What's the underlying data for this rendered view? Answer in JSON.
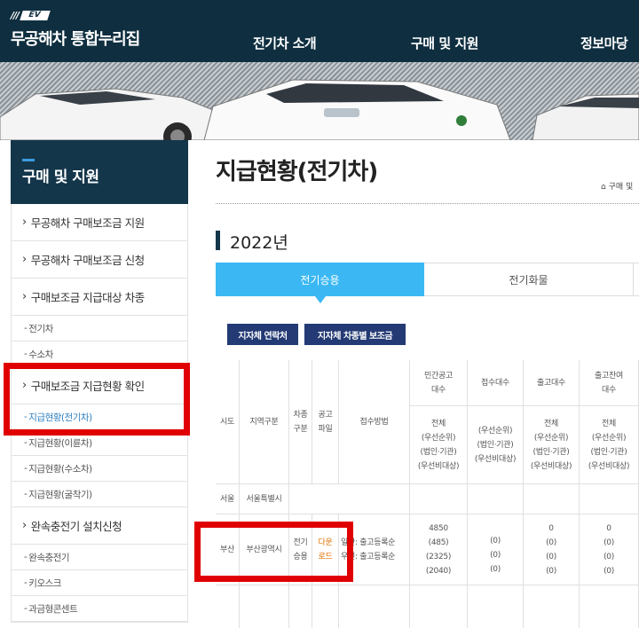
{
  "header": {
    "logo_slashes": "///",
    "logo_badge": "EV",
    "logo_title": "무공해차 통합누리집",
    "nav": [
      "전기차 소개",
      "구매 및 지원",
      "정보마당"
    ]
  },
  "sidebar": {
    "title": "구매 및 지원",
    "items": [
      {
        "label": "무공해차 구매보조금 지원",
        "type": "main"
      },
      {
        "label": "무공해차 구매보조금 신청",
        "type": "main"
      },
      {
        "label": "구매보조금 지급대상 차종",
        "type": "main"
      },
      {
        "label": "전기차",
        "type": "sub"
      },
      {
        "label": "수소차",
        "type": "sub"
      },
      {
        "label": "구매보조금 지급현황 확인",
        "type": "main"
      },
      {
        "label": "지급현황(전기차)",
        "type": "sub",
        "active": true
      },
      {
        "label": "지급현황(이륜차)",
        "type": "sub"
      },
      {
        "label": "지급현황(수소차)",
        "type": "sub"
      },
      {
        "label": "지급현황(굴착기)",
        "type": "sub"
      },
      {
        "label": "완속충전기 설치신청",
        "type": "main"
      },
      {
        "label": "완속충전기",
        "type": "sub"
      },
      {
        "label": "키오스크",
        "type": "sub"
      },
      {
        "label": "과금형콘센트",
        "type": "sub"
      }
    ]
  },
  "main": {
    "page_title": "지급현황(전기차)",
    "breadcrumb": "⌂ 구매 및",
    "year": "2022년",
    "tabs": [
      {
        "label": "전기승용",
        "active": true
      },
      {
        "label": "전기화물",
        "active": false
      }
    ],
    "buttons": [
      "지자체 연락처",
      "지자체 차종별 보조금"
    ]
  },
  "table": {
    "headers": {
      "sido": "시도",
      "region": "지역구분",
      "vehicle_type": "차종\n구분",
      "notice_file": "공고\n파일",
      "method": "접수방법",
      "col_private": "민간공고\n대수",
      "col_received": "접수대수",
      "col_released": "출고대수",
      "col_remaining": "출고잔여\n대수",
      "sub_private": "전체\n(우선순위)\n(법인·기관)\n(우선비대상)",
      "sub_received": "(우선순위)\n(법인·기관)\n(우선비대상)",
      "sub_released": "전체\n(우선순위)\n(법인·기관)\n(우선비대상)",
      "sub_remaining": "전체\n(우선순위)\n(법인·기관)\n(우선비대상)"
    },
    "rows": [
      {
        "sido": "서울",
        "region": "서울특별시",
        "vehicle_type": "",
        "notice_file": "",
        "method": "",
        "private": "",
        "received": "",
        "released": "",
        "remaining": ""
      },
      {
        "sido": "부산",
        "region": "부산광역시",
        "vehicle_type": "전기\n승용",
        "notice_file": "다운\n로드",
        "method": "일반: 출고등록순\n우선: 출고등록순",
        "private": "4850\n(485)\n(2325)\n(2040)",
        "received": "(0)\n(0)\n(0)",
        "released": "0\n(0)\n(0)\n(0)",
        "remaining": "0\n(0)\n(0)\n(0)"
      }
    ]
  },
  "colors": {
    "header_bg": "#0f2f40",
    "sidebar_head_bg": "#14364b",
    "tab_active": "#3bb8f3",
    "button_bg": "#233a74",
    "highlight": "#e00000",
    "download_link": "#e07000",
    "active_sub": "#2c7fc2"
  },
  "icons": [
    "home-icon"
  ]
}
